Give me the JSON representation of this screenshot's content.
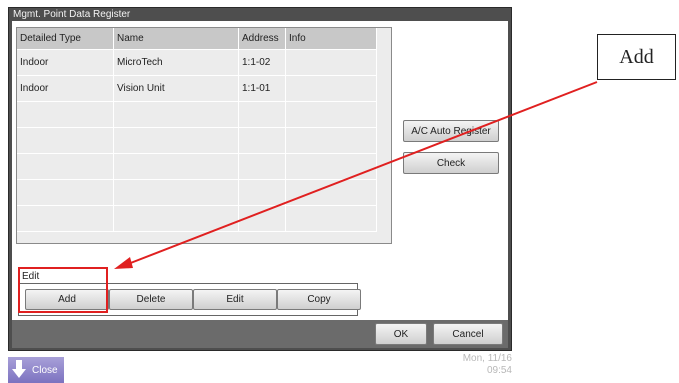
{
  "window": {
    "title": "Mgmt. Point Data Register"
  },
  "table": {
    "headers": [
      "Detailed Type",
      "Name",
      "Address",
      "Info"
    ],
    "rows": [
      [
        "Indoor",
        "MicroTech",
        "1:1-02",
        ""
      ],
      [
        "Indoor",
        "Vision Unit",
        "1:1-01",
        ""
      ],
      [
        "",
        "",
        "",
        ""
      ],
      [
        "",
        "",
        "",
        ""
      ],
      [
        "",
        "",
        "",
        ""
      ],
      [
        "",
        "",
        "",
        ""
      ],
      [
        "",
        "",
        "",
        ""
      ]
    ]
  },
  "side_buttons": {
    "auto_register": "A/C Auto Register",
    "check": "Check"
  },
  "edit": {
    "label": "Edit",
    "add": "Add",
    "delete": "Delete",
    "edit": "Edit",
    "copy": "Copy"
  },
  "footer": {
    "ok": "OK",
    "cancel": "Cancel"
  },
  "taskbar": {
    "close": "Close",
    "date": "Mon, 11/16",
    "time": "09:54"
  },
  "annotation": {
    "callout": "Add",
    "highlight_color": "#e02020"
  }
}
